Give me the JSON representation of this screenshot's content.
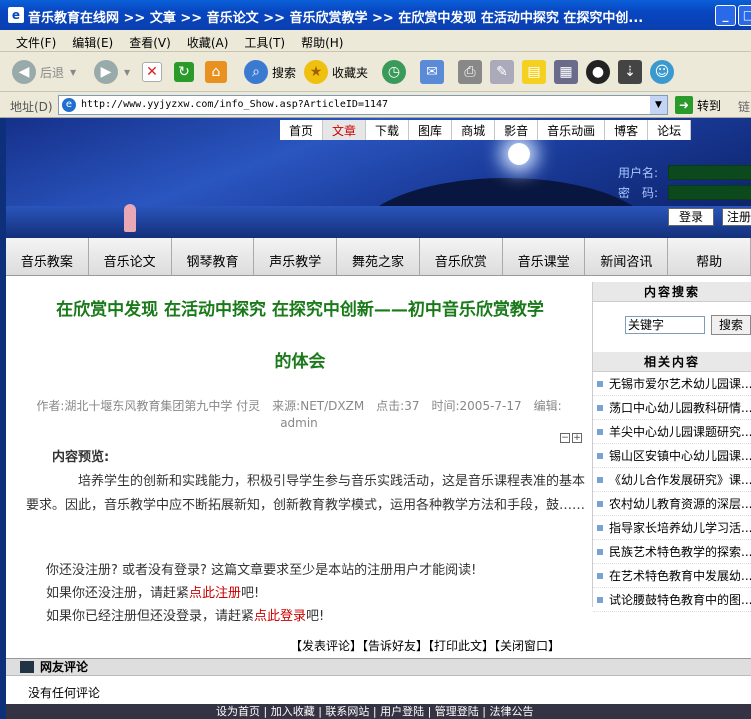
{
  "window": {
    "title": "音乐教育在线网 >> 文章 >> 音乐论文 >> 音乐欣赏教学 >> 在欣赏中发现 在活动中探究 在探究中创..."
  },
  "menu": [
    "文件(F)",
    "编辑(E)",
    "查看(V)",
    "收藏(A)",
    "工具(T)",
    "帮助(H)"
  ],
  "toolbar": {
    "back": "后退",
    "search": "搜索",
    "favorites": "收藏夹"
  },
  "address": {
    "label": "地址(D)",
    "url": "http://www.yyjyzxw.com/info_Show.asp?ArticleID=1147",
    "go": "转到",
    "links": "链"
  },
  "site": {
    "top_nav": [
      "首页",
      "文章",
      "下载",
      "图库",
      "商城",
      "影音",
      "音乐动画",
      "博客",
      "论坛"
    ],
    "login": {
      "username_label": "用户名:",
      "password_label": "密　码:",
      "login_button": "登录",
      "register_button": "注册"
    },
    "category_nav": [
      "音乐教案",
      "音乐论文",
      "钢琴教育",
      "声乐教学",
      "舞苑之家",
      "音乐欣赏",
      "音乐课堂",
      "新闻咨讯",
      "帮助"
    ]
  },
  "article": {
    "title_line1": "在欣赏中发现 在活动中探究 在探究中创新——初中音乐欣赏教学",
    "title_line2": "的体会",
    "meta": "作者:湖北十堰东风教育集团第九中学 付灵　来源:NET/DXZM　点击:37　时间:2005-7-17　编辑:",
    "editor": "admin",
    "preview_label": "内容预览:",
    "preview_text": "培养学生的创新和实践能力，积极引导学生参与音乐实践活动，这是音乐课程表准的基本要求。因此，音乐教学中应不断拓展新知，创新教育教学模式，运用各种教学方法和手段，鼓……",
    "notice_line1": "你还没注册? 或者没有登录? 这篇文章要求至少是本站的注册用户才能阅读!",
    "notice_line2_prefix": "如果你还没注册，请赶紧",
    "notice_line2_link": "点此注册",
    "notice_line2_suffix": "吧!",
    "notice_line3_prefix": "如果你已经注册但还没登录，请赶紧",
    "notice_line3_link": "点此登录",
    "notice_line3_suffix": "吧!",
    "actions": [
      "【发表评论】",
      "【告诉好友】",
      "【打印此文】",
      "【关闭窗口】"
    ]
  },
  "sidebar": {
    "search_title": "内容搜索",
    "search_keyword": "关键字",
    "search_button": "搜索",
    "related_title": "相关内容",
    "related": [
      "无锡市爱尔艺术幼儿园课...",
      "荡口中心幼儿园教科研情...",
      "羊尖中心幼儿园课题研究...",
      "锡山区安镇中心幼儿园课...",
      "《幼儿合作发展研究》课...",
      "农村幼儿教育资源的深层...",
      "指导家长培养幼儿学习活...",
      "民族艺术特色教学的探索...",
      "在艺术特色教育中发展幼...",
      "试论腰鼓特色教育中的图..."
    ]
  },
  "comments": {
    "title": "网友评论",
    "empty": "没有任何评论"
  },
  "footer": "设为首页 | 加入收藏 | 联系网站 | 用户登陆 | 管理登陆 | 法律公告"
}
